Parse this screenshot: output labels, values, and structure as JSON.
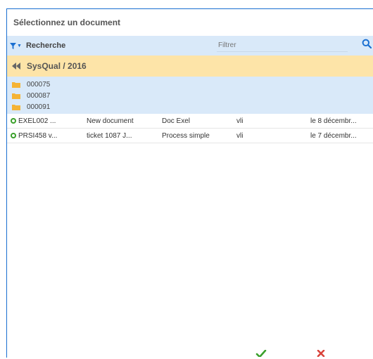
{
  "dialog": {
    "title": "Sélectionnez un document"
  },
  "toolbar": {
    "filter_icon": "filter-icon",
    "search_label": "Recherche",
    "filter_placeholder": "Filtrer",
    "search_icon": "search-icon"
  },
  "breadcrumb": {
    "label": "SysQual / 2016",
    "icon": "double-chevron-left-icon"
  },
  "folders": [
    {
      "name": "000075"
    },
    {
      "name": "000087"
    },
    {
      "name": "000091"
    }
  ],
  "documents": [
    {
      "code": "EXEL002 ...",
      "title": "New document",
      "type": "Doc Exel",
      "user": "vli",
      "date": "le 8 décembr..."
    },
    {
      "code": "PRSI458 v...",
      "title": "ticket 1087 J...",
      "type": "Process simple",
      "user": "vli",
      "date": "le 7 décembr..."
    }
  ],
  "footer": {
    "confirm_icon": "check-icon",
    "cancel_icon": "close-icon"
  },
  "colors": {
    "accent": "#1a6fd1",
    "toolbar_bg": "#d9e9f9",
    "breadcrumb_bg": "#fde4a8",
    "folder": "#f5b335",
    "status_green": "#3aa02b",
    "cancel_red": "#d9433a"
  }
}
